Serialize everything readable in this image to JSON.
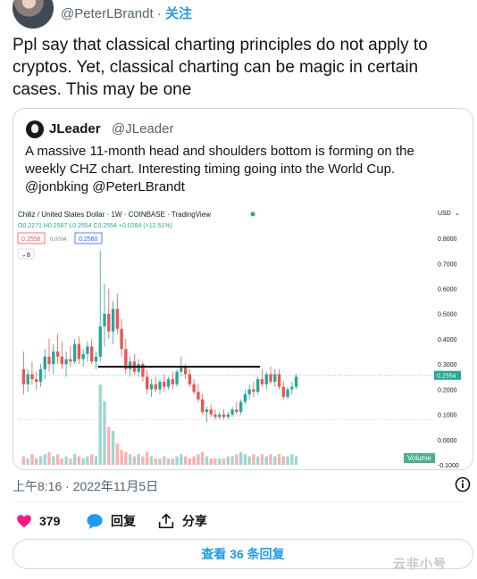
{
  "tweet": {
    "handle": "@PeterLBrandt",
    "separator": "·",
    "follow_label": "关注",
    "text": "Ppl say that classical charting principles do not apply to cryptos. Yet, classical charting can be magic in certain cases. This may be one",
    "timestamp": "上午8:16 · 2022年11月5日"
  },
  "quote": {
    "name": "JLeader",
    "handle": "@JLeader",
    "text": "A massive 11-month head and shoulders bottom is forming on the weekly CHZ chart.  Interesting timing going into the World Cup. @jonbking @PeterLBrandt"
  },
  "chart_header": {
    "title": "Chiliz / United States Dollar · 1W · COINBASE · TradingView",
    "currency": "USD",
    "ohlc": "O0.2271 H0.2587 L0.2554 C0.2554 +0.0284 (+12.51%)",
    "bid": "0.2556",
    "spread": "0.0004",
    "ask": "0.2560",
    "indicator_count": "8",
    "last_price": "0.2554",
    "volume_label": "Volume",
    "y_ticks": [
      "0.8000",
      "0.7000",
      "0.6000",
      "0.5000",
      "0.4000",
      "0.3000",
      "0.2000",
      "0.1000",
      "0.0000",
      "-0.1000"
    ]
  },
  "chart_data": {
    "type": "candlestick",
    "title": "Chiliz / United States Dollar · 1W · COINBASE · TradingView",
    "ylim": [
      -0.1,
      0.85
    ],
    "y_ticks": [
      0.8,
      0.7,
      0.6,
      0.5,
      0.4,
      0.3,
      0.2,
      0.1,
      0.0,
      -0.1
    ],
    "neckline": 0.29,
    "support": 0.08,
    "last_price": 0.2554,
    "candles": [
      {
        "o": 0.28,
        "h": 0.35,
        "l": 0.18,
        "c": 0.22
      },
      {
        "o": 0.22,
        "h": 0.28,
        "l": 0.19,
        "c": 0.26
      },
      {
        "o": 0.26,
        "h": 0.31,
        "l": 0.22,
        "c": 0.24
      },
      {
        "o": 0.24,
        "h": 0.27,
        "l": 0.2,
        "c": 0.23
      },
      {
        "o": 0.23,
        "h": 0.3,
        "l": 0.21,
        "c": 0.28
      },
      {
        "o": 0.28,
        "h": 0.36,
        "l": 0.24,
        "c": 0.33
      },
      {
        "o": 0.33,
        "h": 0.4,
        "l": 0.27,
        "c": 0.3
      },
      {
        "o": 0.3,
        "h": 0.38,
        "l": 0.26,
        "c": 0.35
      },
      {
        "o": 0.35,
        "h": 0.42,
        "l": 0.3,
        "c": 0.33
      },
      {
        "o": 0.33,
        "h": 0.39,
        "l": 0.28,
        "c": 0.3
      },
      {
        "o": 0.3,
        "h": 0.35,
        "l": 0.25,
        "c": 0.32
      },
      {
        "o": 0.32,
        "h": 0.37,
        "l": 0.29,
        "c": 0.31
      },
      {
        "o": 0.31,
        "h": 0.4,
        "l": 0.3,
        "c": 0.38
      },
      {
        "o": 0.38,
        "h": 0.41,
        "l": 0.3,
        "c": 0.32
      },
      {
        "o": 0.32,
        "h": 0.36,
        "l": 0.29,
        "c": 0.34
      },
      {
        "o": 0.34,
        "h": 0.39,
        "l": 0.31,
        "c": 0.37
      },
      {
        "o": 0.37,
        "h": 0.4,
        "l": 0.3,
        "c": 0.31
      },
      {
        "o": 0.31,
        "h": 0.35,
        "l": 0.28,
        "c": 0.33
      },
      {
        "o": 0.33,
        "h": 0.75,
        "l": 0.31,
        "c": 0.45
      },
      {
        "o": 0.45,
        "h": 0.62,
        "l": 0.37,
        "c": 0.5
      },
      {
        "o": 0.5,
        "h": 0.6,
        "l": 0.4,
        "c": 0.43
      },
      {
        "o": 0.43,
        "h": 0.55,
        "l": 0.38,
        "c": 0.52
      },
      {
        "o": 0.52,
        "h": 0.58,
        "l": 0.42,
        "c": 0.44
      },
      {
        "o": 0.44,
        "h": 0.48,
        "l": 0.33,
        "c": 0.36
      },
      {
        "o": 0.36,
        "h": 0.4,
        "l": 0.26,
        "c": 0.28
      },
      {
        "o": 0.28,
        "h": 0.33,
        "l": 0.25,
        "c": 0.31
      },
      {
        "o": 0.31,
        "h": 0.34,
        "l": 0.26,
        "c": 0.27
      },
      {
        "o": 0.27,
        "h": 0.32,
        "l": 0.25,
        "c": 0.3
      },
      {
        "o": 0.3,
        "h": 0.31,
        "l": 0.23,
        "c": 0.25
      },
      {
        "o": 0.25,
        "h": 0.28,
        "l": 0.18,
        "c": 0.2
      },
      {
        "o": 0.2,
        "h": 0.24,
        "l": 0.17,
        "c": 0.22
      },
      {
        "o": 0.22,
        "h": 0.25,
        "l": 0.19,
        "c": 0.2
      },
      {
        "o": 0.2,
        "h": 0.24,
        "l": 0.18,
        "c": 0.23
      },
      {
        "o": 0.23,
        "h": 0.26,
        "l": 0.19,
        "c": 0.21
      },
      {
        "o": 0.21,
        "h": 0.25,
        "l": 0.2,
        "c": 0.24
      },
      {
        "o": 0.24,
        "h": 0.27,
        "l": 0.2,
        "c": 0.22
      },
      {
        "o": 0.22,
        "h": 0.28,
        "l": 0.21,
        "c": 0.27
      },
      {
        "o": 0.27,
        "h": 0.33,
        "l": 0.25,
        "c": 0.29
      },
      {
        "o": 0.29,
        "h": 0.3,
        "l": 0.24,
        "c": 0.26
      },
      {
        "o": 0.26,
        "h": 0.28,
        "l": 0.21,
        "c": 0.22
      },
      {
        "o": 0.22,
        "h": 0.24,
        "l": 0.18,
        "c": 0.19
      },
      {
        "o": 0.19,
        "h": 0.22,
        "l": 0.15,
        "c": 0.16
      },
      {
        "o": 0.16,
        "h": 0.18,
        "l": 0.1,
        "c": 0.11
      },
      {
        "o": 0.11,
        "h": 0.13,
        "l": 0.07,
        "c": 0.12
      },
      {
        "o": 0.12,
        "h": 0.14,
        "l": 0.09,
        "c": 0.1
      },
      {
        "o": 0.1,
        "h": 0.12,
        "l": 0.08,
        "c": 0.09
      },
      {
        "o": 0.09,
        "h": 0.11,
        "l": 0.08,
        "c": 0.1
      },
      {
        "o": 0.1,
        "h": 0.12,
        "l": 0.08,
        "c": 0.09
      },
      {
        "o": 0.09,
        "h": 0.11,
        "l": 0.08,
        "c": 0.1
      },
      {
        "o": 0.1,
        "h": 0.13,
        "l": 0.09,
        "c": 0.12
      },
      {
        "o": 0.12,
        "h": 0.15,
        "l": 0.1,
        "c": 0.11
      },
      {
        "o": 0.11,
        "h": 0.16,
        "l": 0.1,
        "c": 0.15
      },
      {
        "o": 0.15,
        "h": 0.2,
        "l": 0.14,
        "c": 0.18
      },
      {
        "o": 0.18,
        "h": 0.22,
        "l": 0.16,
        "c": 0.2
      },
      {
        "o": 0.2,
        "h": 0.23,
        "l": 0.17,
        "c": 0.19
      },
      {
        "o": 0.19,
        "h": 0.25,
        "l": 0.18,
        "c": 0.24
      },
      {
        "o": 0.24,
        "h": 0.28,
        "l": 0.21,
        "c": 0.22
      },
      {
        "o": 0.22,
        "h": 0.27,
        "l": 0.2,
        "c": 0.26
      },
      {
        "o": 0.26,
        "h": 0.29,
        "l": 0.22,
        "c": 0.23
      },
      {
        "o": 0.23,
        "h": 0.28,
        "l": 0.21,
        "c": 0.26
      },
      {
        "o": 0.26,
        "h": 0.28,
        "l": 0.2,
        "c": 0.21
      },
      {
        "o": 0.21,
        "h": 0.23,
        "l": 0.16,
        "c": 0.17
      },
      {
        "o": 0.17,
        "h": 0.21,
        "l": 0.16,
        "c": 0.2
      },
      {
        "o": 0.2,
        "h": 0.23,
        "l": 0.18,
        "c": 0.21
      },
      {
        "o": 0.21,
        "h": 0.26,
        "l": 0.2,
        "c": 0.25
      }
    ],
    "volume": [
      0.04,
      0.03,
      0.05,
      0.03,
      0.04,
      0.05,
      0.06,
      0.04,
      0.05,
      0.03,
      0.04,
      0.03,
      0.05,
      0.04,
      0.03,
      0.04,
      0.05,
      0.04,
      0.38,
      0.3,
      0.18,
      0.16,
      0.1,
      0.07,
      0.06,
      0.05,
      0.04,
      0.05,
      0.04,
      0.06,
      0.04,
      0.03,
      0.03,
      0.04,
      0.03,
      0.03,
      0.04,
      0.05,
      0.04,
      0.03,
      0.04,
      0.05,
      0.06,
      0.04,
      0.03,
      0.03,
      0.03,
      0.03,
      0.04,
      0.04,
      0.05,
      0.06,
      0.05,
      0.04,
      0.05,
      0.04,
      0.05,
      0.04,
      0.05,
      0.04,
      0.05,
      0.04,
      0.04,
      0.05,
      0.04
    ]
  },
  "actions": {
    "like_count": "379",
    "reply_label": "回复",
    "share_label": "分享",
    "view_replies": "查看 36 条回复"
  },
  "watermark": "云非小号",
  "colors": {
    "up": "#26a69a",
    "down": "#ef5350",
    "like": "#f91880",
    "link": "#1d9bf0",
    "muted": "#536471"
  }
}
